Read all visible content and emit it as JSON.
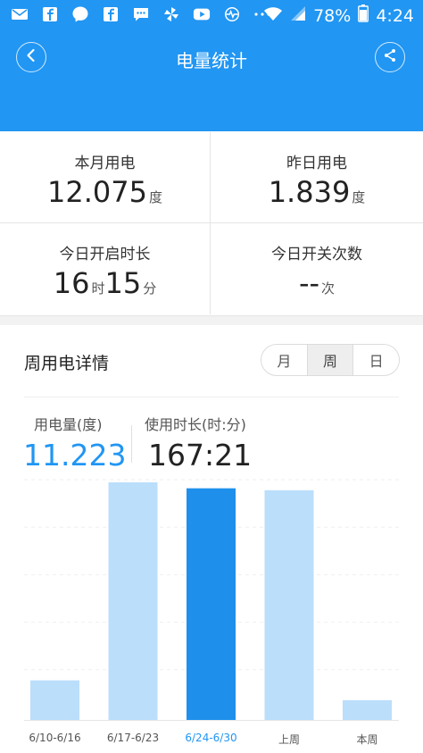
{
  "status_bar": {
    "battery_percent": "78%",
    "time": "4:24",
    "left_icons": [
      "mail-icon",
      "facebook-icon",
      "messenger-icon",
      "facebook-icon",
      "chat-icon",
      "pinwheel-icon",
      "youtube-icon",
      "pulse-icon",
      "more-dots-icon"
    ],
    "right_icons": [
      "wifi-icon",
      "signal-icon",
      "battery-icon"
    ]
  },
  "header": {
    "title": "电量统计",
    "back_icon": "chevron-left-icon",
    "share_icon": "share-icon"
  },
  "stats": [
    {
      "label": "本月用电",
      "value": "12.075",
      "unit": "度"
    },
    {
      "label": "昨日用电",
      "value": "1.839",
      "unit": "度"
    },
    {
      "label": "今日开启时长",
      "hours": "16",
      "hours_unit": "时",
      "minutes": "15",
      "minutes_unit": "分"
    },
    {
      "label": "今日开关次数",
      "value": "--",
      "unit": "次"
    }
  ],
  "weekly": {
    "title": "周用电详情",
    "tabs": [
      {
        "label": "月"
      },
      {
        "label": "周",
        "active": true
      },
      {
        "label": "日"
      }
    ],
    "energy_label": "用电量(度)",
    "energy_value": "11.223",
    "duration_label": "使用时长(时:分)",
    "duration_value": "167:21"
  },
  "colors": {
    "accent": "#2196F3",
    "bar_inactive": "#BBDEFB",
    "bar_active": "#1E90EC"
  },
  "chart_data": {
    "type": "bar",
    "categories": [
      "6/10-6/16",
      "6/17-6/23",
      "6/24-6/30",
      "上周",
      "本周"
    ],
    "values": [
      2.0,
      12.0,
      11.7,
      11.6,
      1.0
    ],
    "active_index": 2,
    "ylim": [
      0,
      12
    ],
    "grid": true,
    "title": "",
    "xlabel": "",
    "ylabel": ""
  }
}
